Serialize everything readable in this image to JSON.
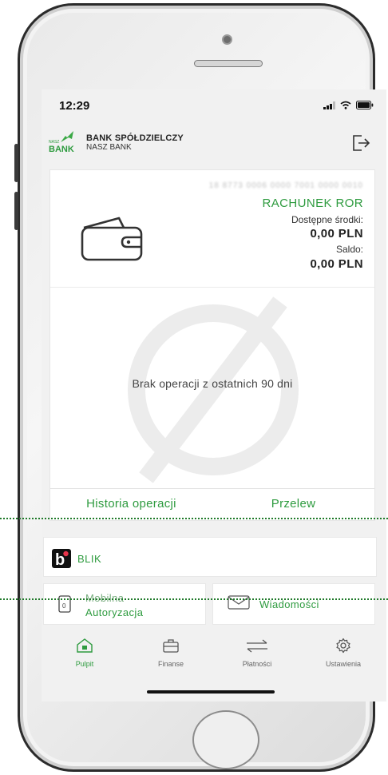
{
  "status": {
    "time": "12:29"
  },
  "header": {
    "logo_small": "NASZ",
    "logo_big": "BANK",
    "bank_name": "BANK SPÓŁDZIELCZY",
    "bank_sub": "NASZ BANK"
  },
  "account": {
    "number": "18 8773 0006 0000 7001 0000 0010",
    "name": "RACHUNEK ROR",
    "available_label": "Dostępne środki:",
    "available_value": "0,00 PLN",
    "balance_label": "Saldo:",
    "balance_value": "0,00 PLN"
  },
  "operations": {
    "empty_text": "Brak operacji z ostatnich 90 dni"
  },
  "actions": {
    "history": "Historia operacji",
    "transfer": "Przelew"
  },
  "blik": {
    "logo": "b",
    "label": "BLIK"
  },
  "tiles": {
    "mobile_line1": "Mobilna",
    "mobile_line2": "Autoryzacja",
    "messages": "Wiadomości"
  },
  "tabs": [
    {
      "label": "Pulpit",
      "icon": "home-icon"
    },
    {
      "label": "Finanse",
      "icon": "briefcase-icon"
    },
    {
      "label": "Płatności",
      "icon": "transfer-arrows-icon"
    },
    {
      "label": "Ustawienia",
      "icon": "gear-icon"
    }
  ],
  "colors": {
    "accent": "#2e9b3f",
    "text": "#222222",
    "background": "#f1f1f1"
  }
}
